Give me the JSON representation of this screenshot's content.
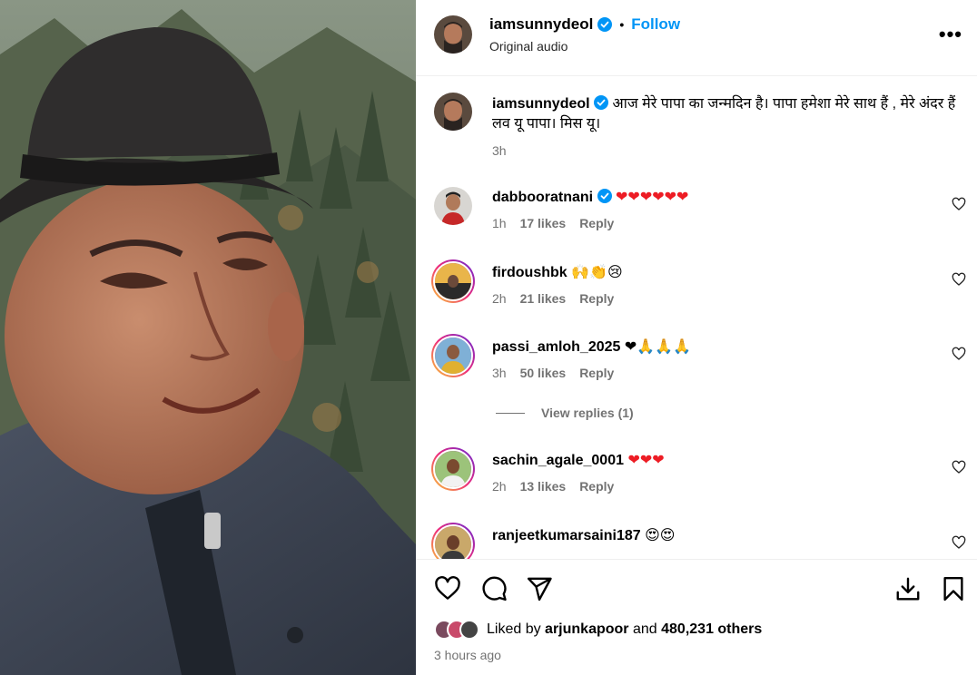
{
  "post": {
    "username": "iamsunnydeol",
    "follow_label": "Follow",
    "audio": "Original audio",
    "more_label": "•••"
  },
  "caption": {
    "username": "iamsunnydeol",
    "text": "आज मेरे पापा का जन्मदिन है। पापा हमेशा मेरे साथ हैं , मेरे अंदर हैं लव यू पापा। मिस यू।",
    "time": "3h"
  },
  "comments": [
    {
      "username": "dabbooratnani",
      "verified": true,
      "text": "❤❤❤❤❤❤",
      "time": "1h",
      "likes": "17 likes",
      "reply": "Reply"
    },
    {
      "username": "firdoushbk",
      "verified": false,
      "text": "🙌👏😢",
      "time": "2h",
      "likes": "21 likes",
      "reply": "Reply"
    },
    {
      "username": "passi_amloh_2025",
      "verified": false,
      "text": "❤🙏🙏🙏",
      "time": "3h",
      "likes": "50 likes",
      "reply": "Reply",
      "view_replies": "View replies (1)"
    },
    {
      "username": "sachin_agale_0001",
      "verified": false,
      "text": "❤❤❤",
      "time": "2h",
      "likes": "13 likes",
      "reply": "Reply"
    },
    {
      "username": "ranjeetkumarsaini187",
      "verified": false,
      "text": "😍😍",
      "time": "",
      "likes": "",
      "reply": ""
    }
  ],
  "footer": {
    "liked_prefix": "Liked by",
    "liked_user": "arjunkapoor",
    "liked_and": "and",
    "liked_count": "480,231 others",
    "time_ago": "3 hours ago"
  },
  "colors": {
    "accent": "#0095f6",
    "heart": "#ed1c24",
    "muted": "#737373"
  }
}
